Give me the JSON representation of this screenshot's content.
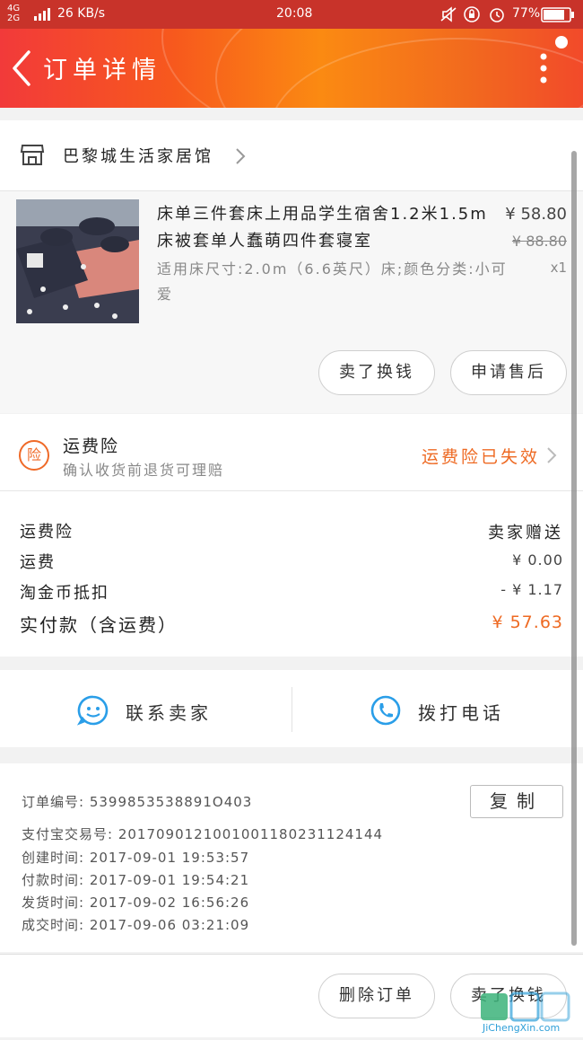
{
  "status_bar": {
    "network": "4G 2G",
    "speed": "26 KB/s",
    "time": "20:08",
    "battery": "77%"
  },
  "header": {
    "title": "订单详情"
  },
  "shop": {
    "name": "巴黎城生活家居馆"
  },
  "product": {
    "title": "床单三件套床上用品学生宿舍1.2米1.5m床被套单人蠢萌四件套寝室",
    "spec": "适用床尺寸:2.0m（6.6英尺）床;颜色分类:小可爱",
    "price": "¥ 58.80",
    "original_price": "¥ 88.80",
    "quantity": "x1"
  },
  "product_actions": {
    "exchange_label": "卖了换钱",
    "after_sale_label": "申请售后"
  },
  "insurance": {
    "icon_text": "险",
    "title": "运费险",
    "subtitle": "确认收货前退货可理赔",
    "status": "运费险已失效"
  },
  "cost_rows": [
    {
      "label": "运费险",
      "value": "卖家赠送"
    },
    {
      "label": "运费",
      "value": "¥ 0.00"
    },
    {
      "label": "淘金币抵扣",
      "value": "- ¥ 1.17"
    }
  ],
  "total": {
    "label": "实付款（含运费）",
    "value": "¥ 57.63"
  },
  "contact": {
    "seller_label": "联系卖家",
    "call_label": "拨打电话"
  },
  "order_info": {
    "order_no": "订单编号:   5399853538891O403",
    "alipay_no": "支付宝交易号:   2017090121001001180231124144",
    "created": "创建时间:   2017-09-01 19:53:57",
    "paid": "付款时间:   2017-09-01 19:54:21",
    "shipped": "发货时间:   2017-09-02 16:56:26",
    "completed": "成交时间:   2017-09-06 03:21:09",
    "copy_label": "复制"
  },
  "bottom_bar": {
    "delete_label": "删除订单",
    "exchange_label": "卖了换钱"
  },
  "watermark": {
    "text": "JiChengXin.com"
  },
  "colors": {
    "accent_orange": "#ee6a23",
    "header_red": "#f23a3a",
    "icon_blue": "#2a9ee8"
  }
}
